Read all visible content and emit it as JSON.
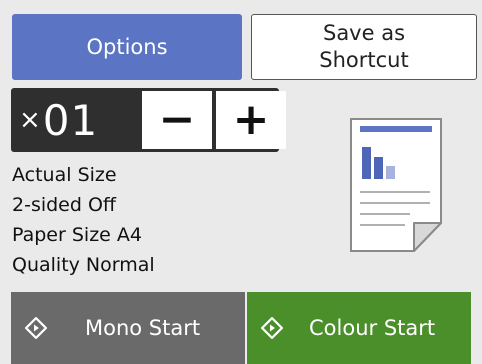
{
  "options_button": {
    "label": "Options"
  },
  "shortcut_button": {
    "label_line1": "Save as",
    "label_line2": "Shortcut"
  },
  "copies": {
    "prefix": "×",
    "value": "01",
    "minus_label": "−",
    "plus_label": "+"
  },
  "settings": [
    "Actual Size",
    "2-sided Off",
    "Paper Size A4",
    "Quality Normal"
  ],
  "document_icon": {
    "name": "document-preview-icon"
  },
  "mono_start": {
    "label": "Mono Start",
    "icon": "diamond-start-icon"
  },
  "colour_start": {
    "label": "Colour Start",
    "icon": "diamond-start-icon"
  },
  "colors": {
    "options_blue": "#5b74c4",
    "mono_gray": "#6a6a6a",
    "colour_green": "#4a8f2a",
    "copies_dark": "#2f2f2f"
  }
}
